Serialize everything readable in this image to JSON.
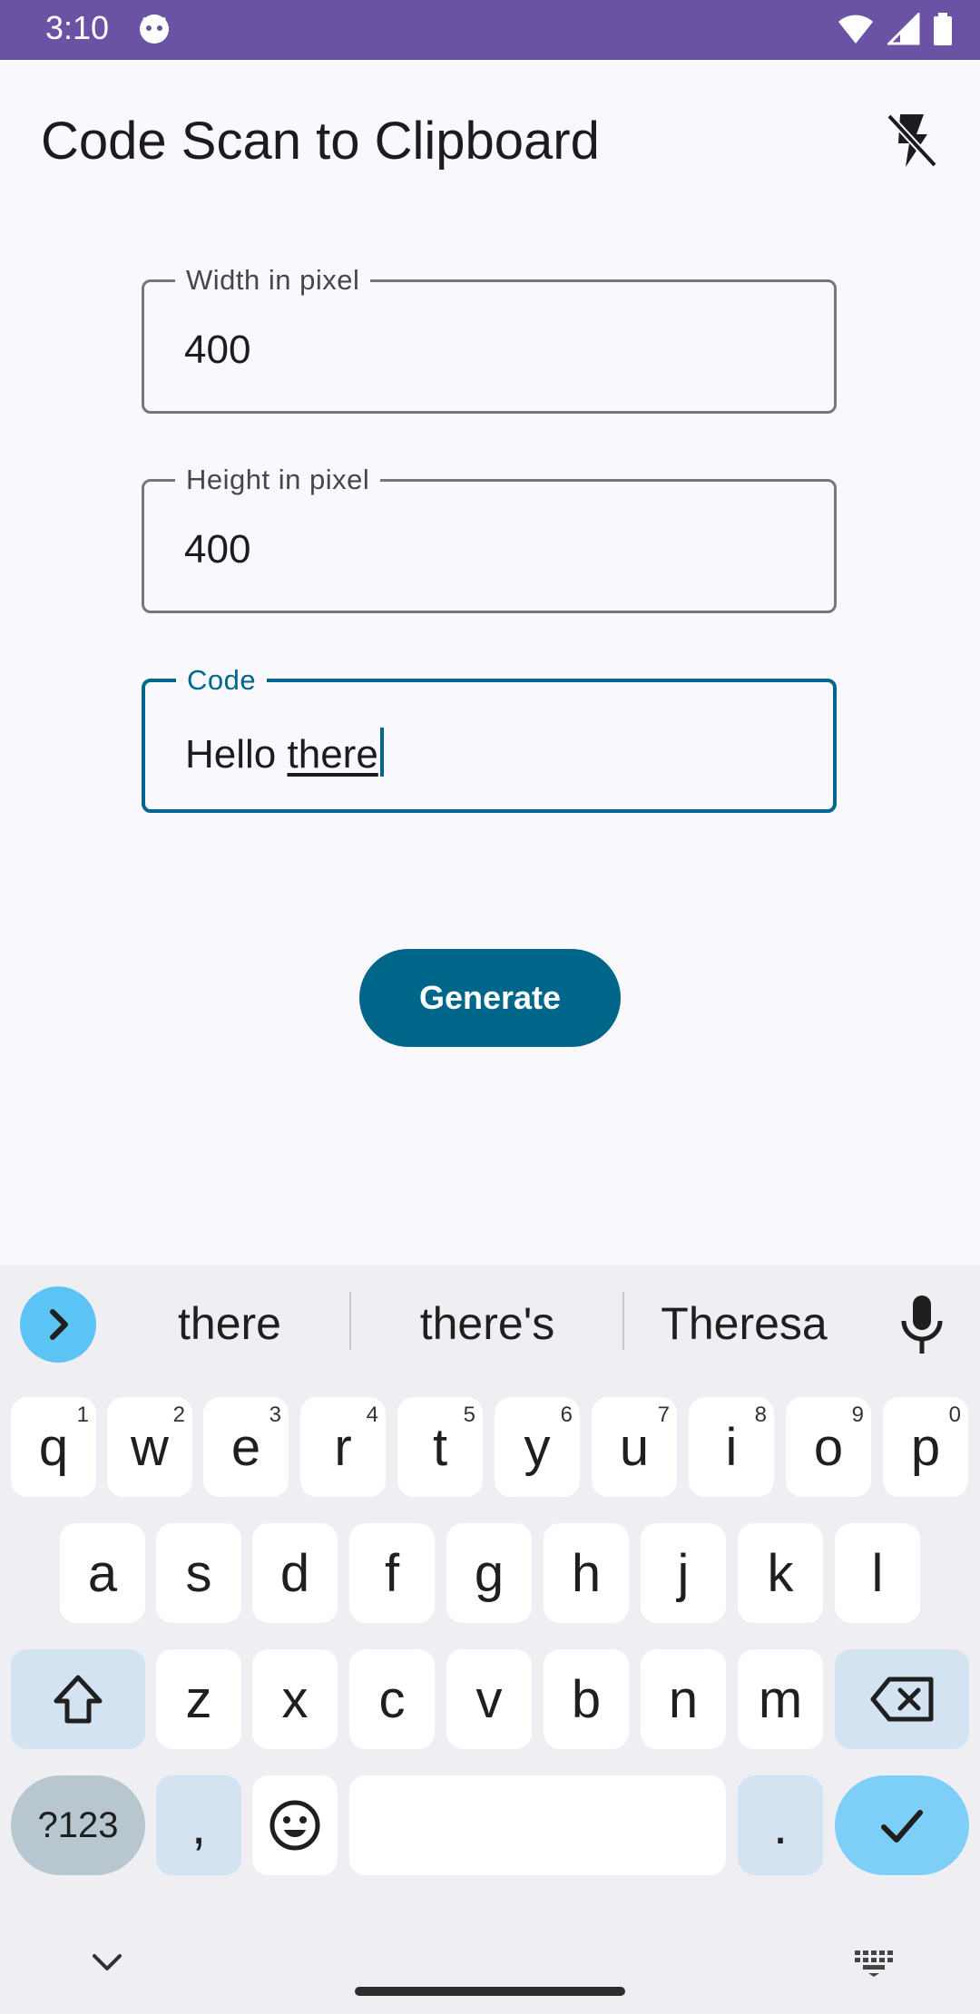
{
  "status_bar": {
    "time": "3:10"
  },
  "app_bar": {
    "title": "Code Scan to Clipboard"
  },
  "form": {
    "width_label": "Width in pixel",
    "width_value": "400",
    "height_label": "Height in pixel",
    "height_value": "400",
    "code_label": "Code",
    "code_value_prefix": "Hello ",
    "code_value_composing": "there",
    "generate_label": "Generate"
  },
  "keyboard": {
    "suggestions": [
      "there",
      "there's",
      "Theresa"
    ],
    "row1": [
      {
        "key": "q",
        "hint": "1"
      },
      {
        "key": "w",
        "hint": "2"
      },
      {
        "key": "e",
        "hint": "3"
      },
      {
        "key": "r",
        "hint": "4"
      },
      {
        "key": "t",
        "hint": "5"
      },
      {
        "key": "y",
        "hint": "6"
      },
      {
        "key": "u",
        "hint": "7"
      },
      {
        "key": "i",
        "hint": "8"
      },
      {
        "key": "o",
        "hint": "9"
      },
      {
        "key": "p",
        "hint": "0"
      }
    ],
    "row2": [
      "a",
      "s",
      "d",
      "f",
      "g",
      "h",
      "j",
      "k",
      "l"
    ],
    "row3": [
      "z",
      "x",
      "c",
      "v",
      "b",
      "n",
      "m"
    ],
    "symbols_label": "?123",
    "comma": ",",
    "period": "."
  },
  "colors": {
    "status_bar": "#6a52a4",
    "accent": "#00668c",
    "button": "#006689",
    "enter_key": "#7dcff7"
  }
}
